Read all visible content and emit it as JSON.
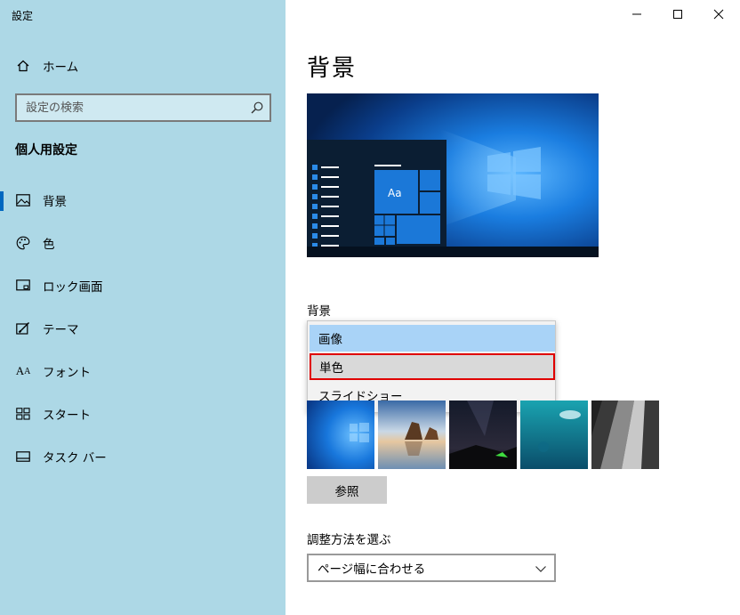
{
  "window": {
    "title": "設定"
  },
  "sidebar": {
    "home_label": "ホーム",
    "search_placeholder": "設定の検索",
    "section_heading": "個人用設定",
    "items": [
      {
        "label": "背景",
        "icon": "picture-icon",
        "selected": true
      },
      {
        "label": "色",
        "icon": "palette-icon",
        "selected": false
      },
      {
        "label": "ロック画面",
        "icon": "lock-screen-icon",
        "selected": false
      },
      {
        "label": "テーマ",
        "icon": "theme-icon",
        "selected": false
      },
      {
        "label": "フォント",
        "icon": "font-icon",
        "selected": false
      },
      {
        "label": "スタート",
        "icon": "start-icon",
        "selected": false
      },
      {
        "label": "タスク バー",
        "icon": "taskbar-icon",
        "selected": false
      }
    ]
  },
  "main": {
    "page_title": "背景",
    "preview_tile_text": "Aa",
    "background_label": "背景",
    "dropdown_options": [
      "画像",
      "単色",
      "スライドショー"
    ],
    "browse_label": "参照",
    "fit_label": "調整方法を選ぶ",
    "fit_value": "ページ幅に合わせる"
  },
  "colors": {
    "sidebar_bg": "#add8e6",
    "accent": "#0067c0",
    "highlight_border": "#e00000",
    "option_hover": "#a9d3f7"
  }
}
